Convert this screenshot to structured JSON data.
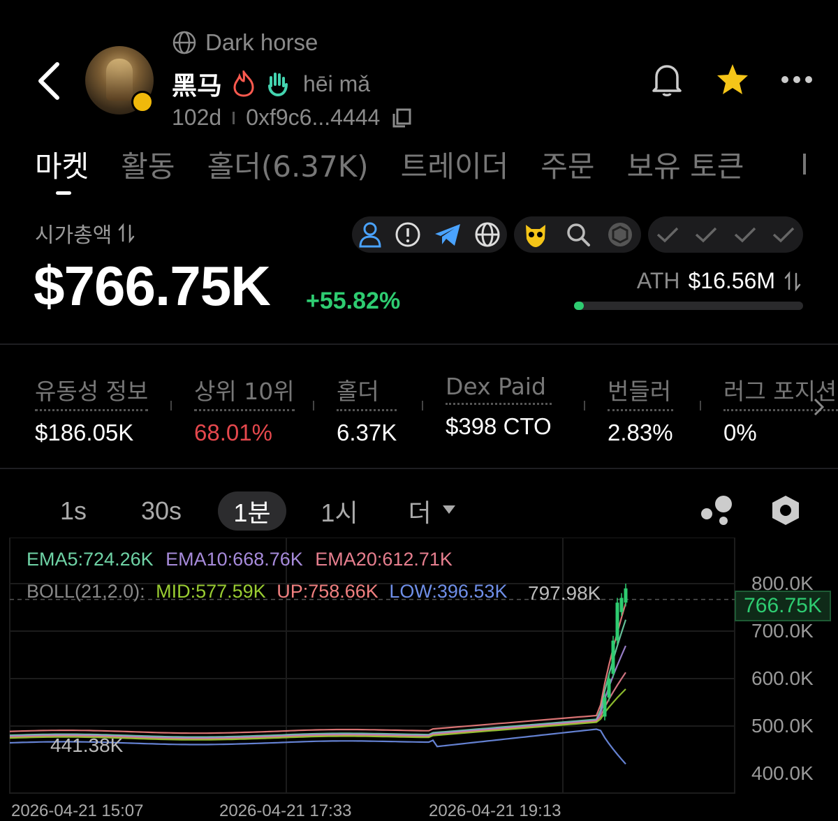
{
  "header": {
    "english_name": "Dark horse",
    "token_name": "黑马",
    "pinyin": "hēi mǎ",
    "age": "102d",
    "address": "0xf9c6...4444",
    "icons": [
      "back-chevron-icon",
      "globe-icon",
      "fire-icon",
      "hand-icon",
      "copy-icon",
      "bell-icon",
      "star-icon",
      "more-icon"
    ],
    "star_color": "#f5c518"
  },
  "tabs": [
    "마켓",
    "활동",
    "홀더(6.37K)",
    "트레이더",
    "주문",
    "보유 토큰"
  ],
  "market_cap": {
    "label": "시가총액",
    "value": "$766.75K",
    "change": "+55.82%",
    "change_color": "#2ecc71"
  },
  "ath": {
    "label": "ATH",
    "value": "$16.56M",
    "progress": 0.03
  },
  "stats": [
    {
      "label": "유동성 정보",
      "value": "$186.05K"
    },
    {
      "label": "상위 10위",
      "value": "68.01%"
    },
    {
      "label": "홀더",
      "value": "6.37K"
    },
    {
      "label": "Dex Paid",
      "value": "$398 CTO"
    },
    {
      "label": "번들러",
      "value": "2.83%"
    },
    {
      "label": "러그 포지션",
      "value": "0%"
    }
  ],
  "timeframes": [
    "1s",
    "30s",
    "1분",
    "1시",
    "더"
  ],
  "active_timeframe": "1분",
  "legend": {
    "ema5": "EMA5:724.26K",
    "ema10": "EMA10:668.76K",
    "ema20": "EMA20:612.71K",
    "boll": "BOLL(21,2.0):",
    "mid": "MID:577.59K",
    "up": "UP:758.66K",
    "low": "LOW:396.53K"
  },
  "chart_data": {
    "type": "line",
    "y_ticks": [
      "800.0K",
      "700.0K",
      "600.0K",
      "500.0K",
      "400.0K"
    ],
    "ylim": [
      400,
      800
    ],
    "x_ticks": [
      "2026-04-21 15:07",
      "2026-04-21 17:33",
      "2026-04-21 19:13"
    ],
    "current_price": "766.75K",
    "high_label": "797.98K",
    "low_label": "441.38K",
    "series_colors": {
      "EMA5": "#6fd3a6",
      "EMA10": "#a78bdb",
      "EMA20": "#e77f8f",
      "MID": "#9acd32",
      "UP": "#f08080",
      "LOW": "#6f8fe8"
    }
  }
}
